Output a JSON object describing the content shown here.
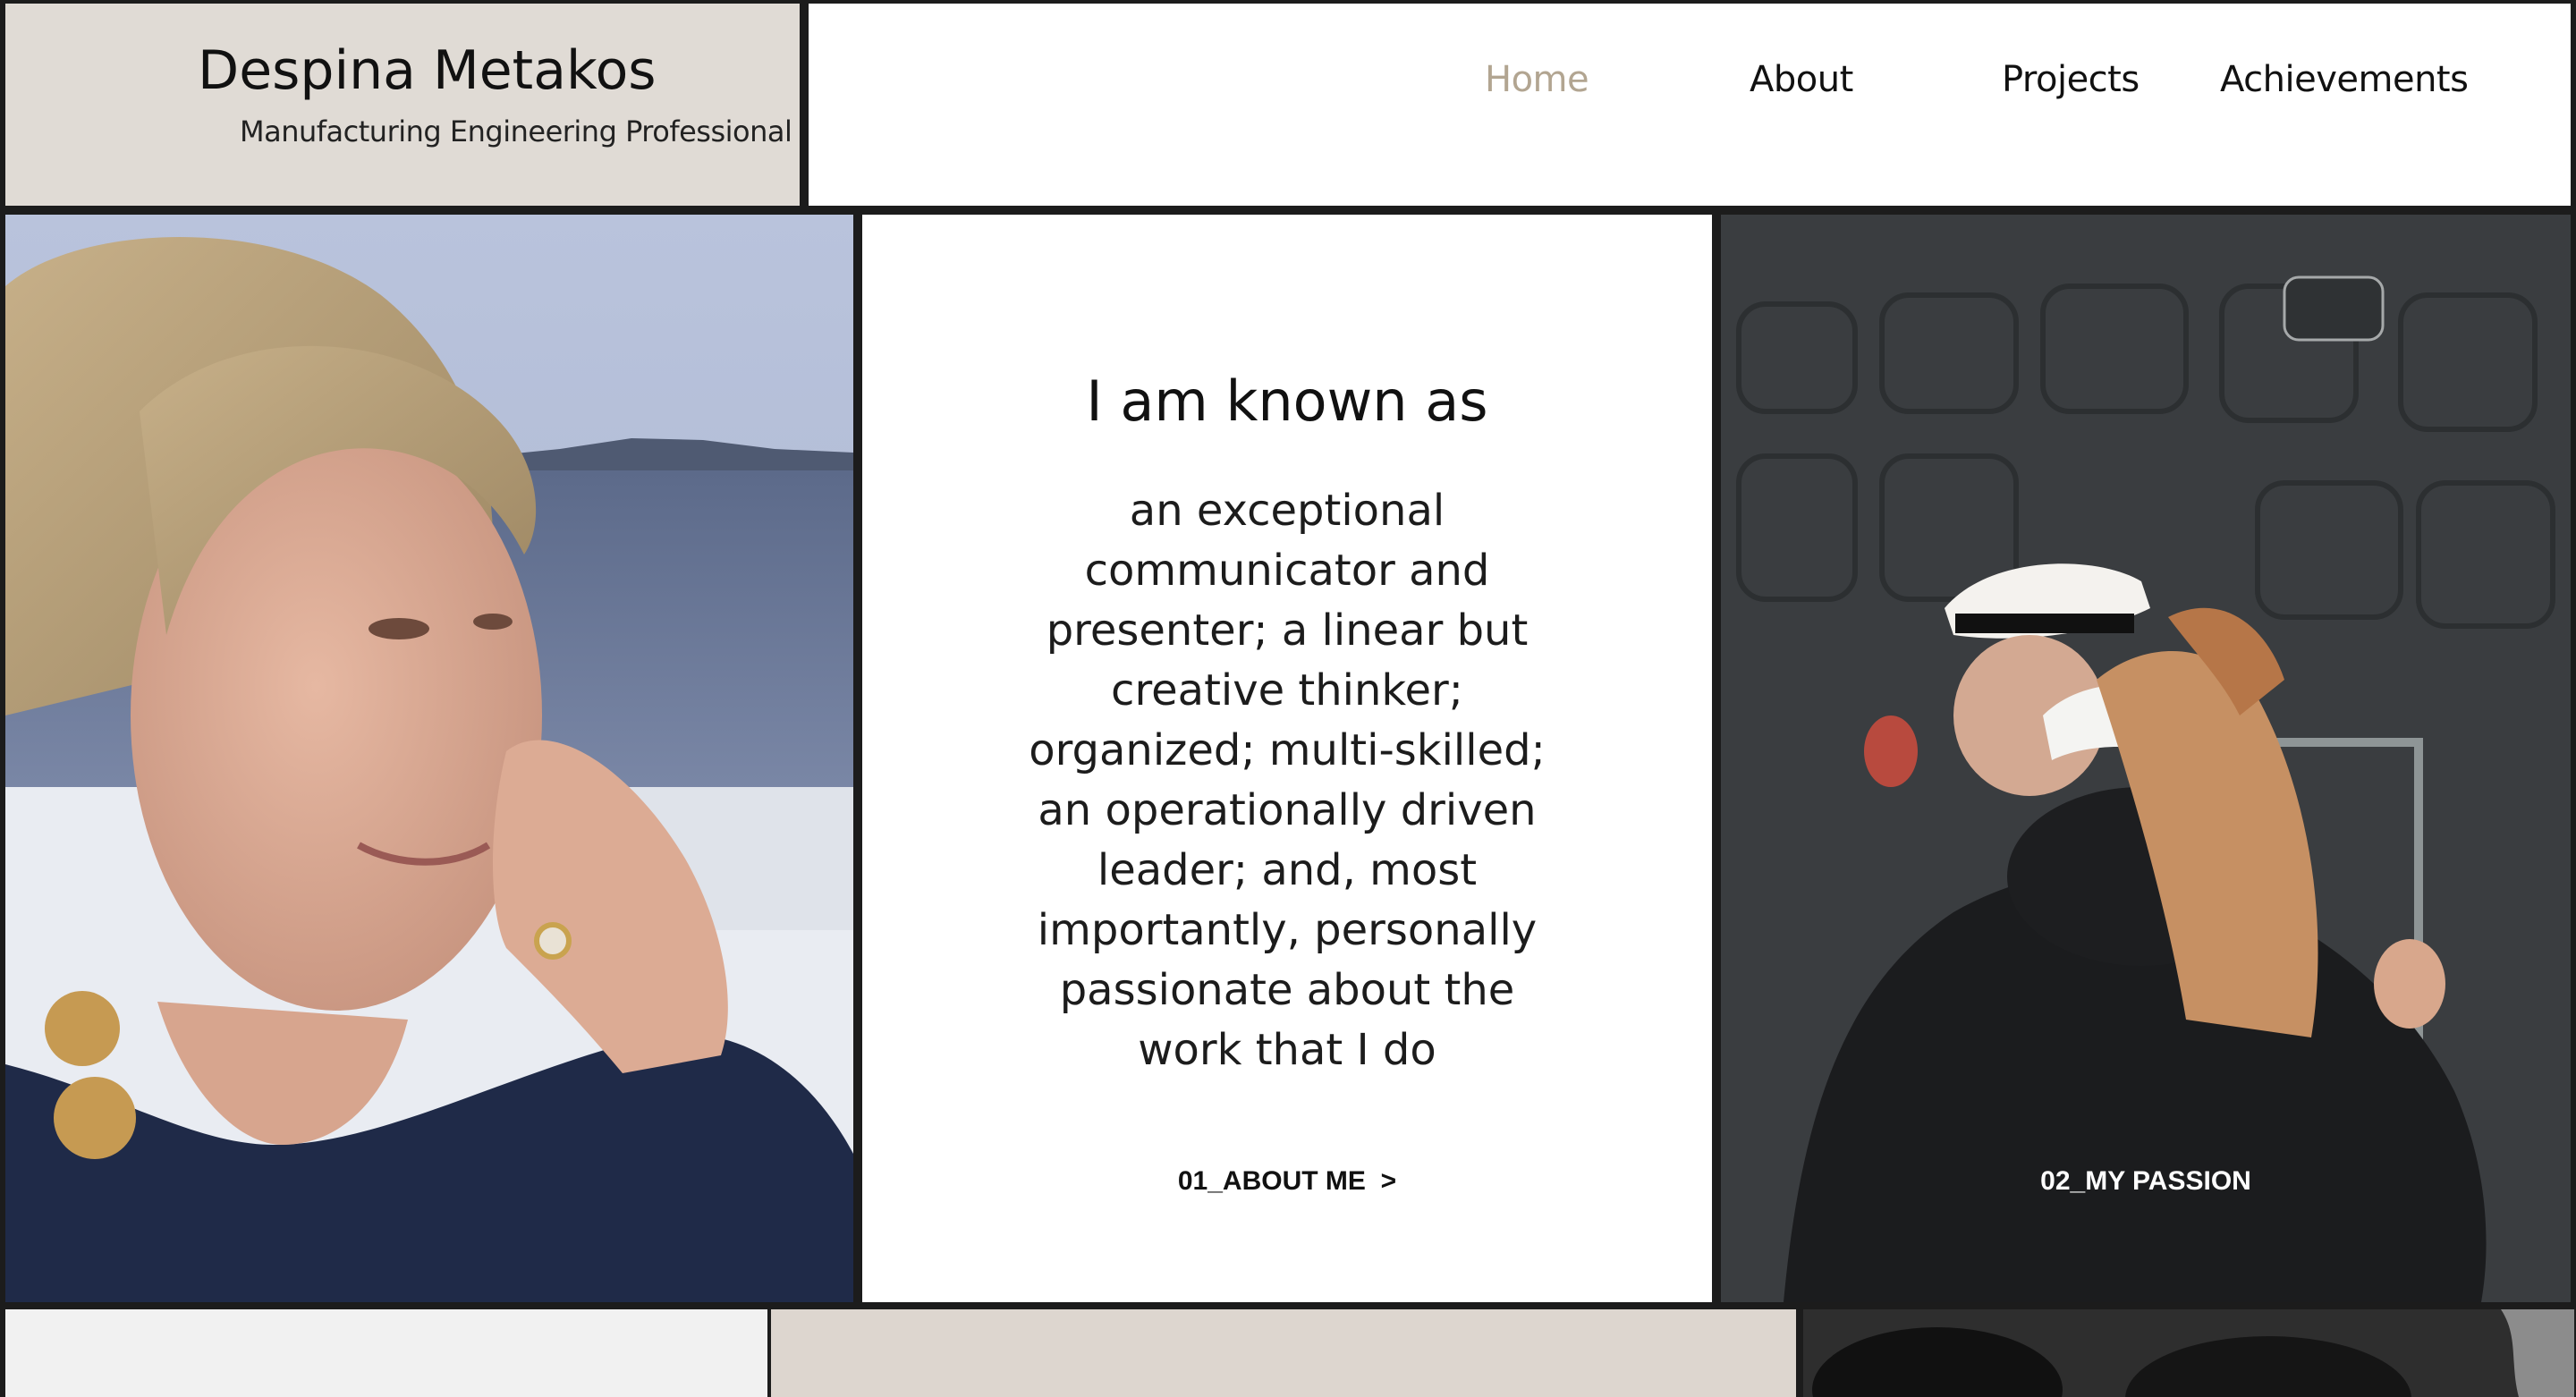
{
  "header": {
    "title": "Despina Metakos",
    "tagline": "Manufacturing Engineering Professional"
  },
  "nav": {
    "items": [
      "Home",
      "About",
      "Projects",
      "Achievements"
    ],
    "active": "Home"
  },
  "intro": {
    "heading": "I am known as",
    "body": "an exceptional communicator and presenter; a linear but creative thinker; organized; multi-skilled; an operationally driven leader; and, most importantly, personally passionate about the work that I do",
    "link_label": "01_ABOUT ME  >"
  },
  "passion": {
    "link_label": "02_MY PASSION"
  },
  "colors": {
    "accent": "#b2a591",
    "brand_panel": "#e0dbd5",
    "grid_gap": "#1c1c1c"
  }
}
